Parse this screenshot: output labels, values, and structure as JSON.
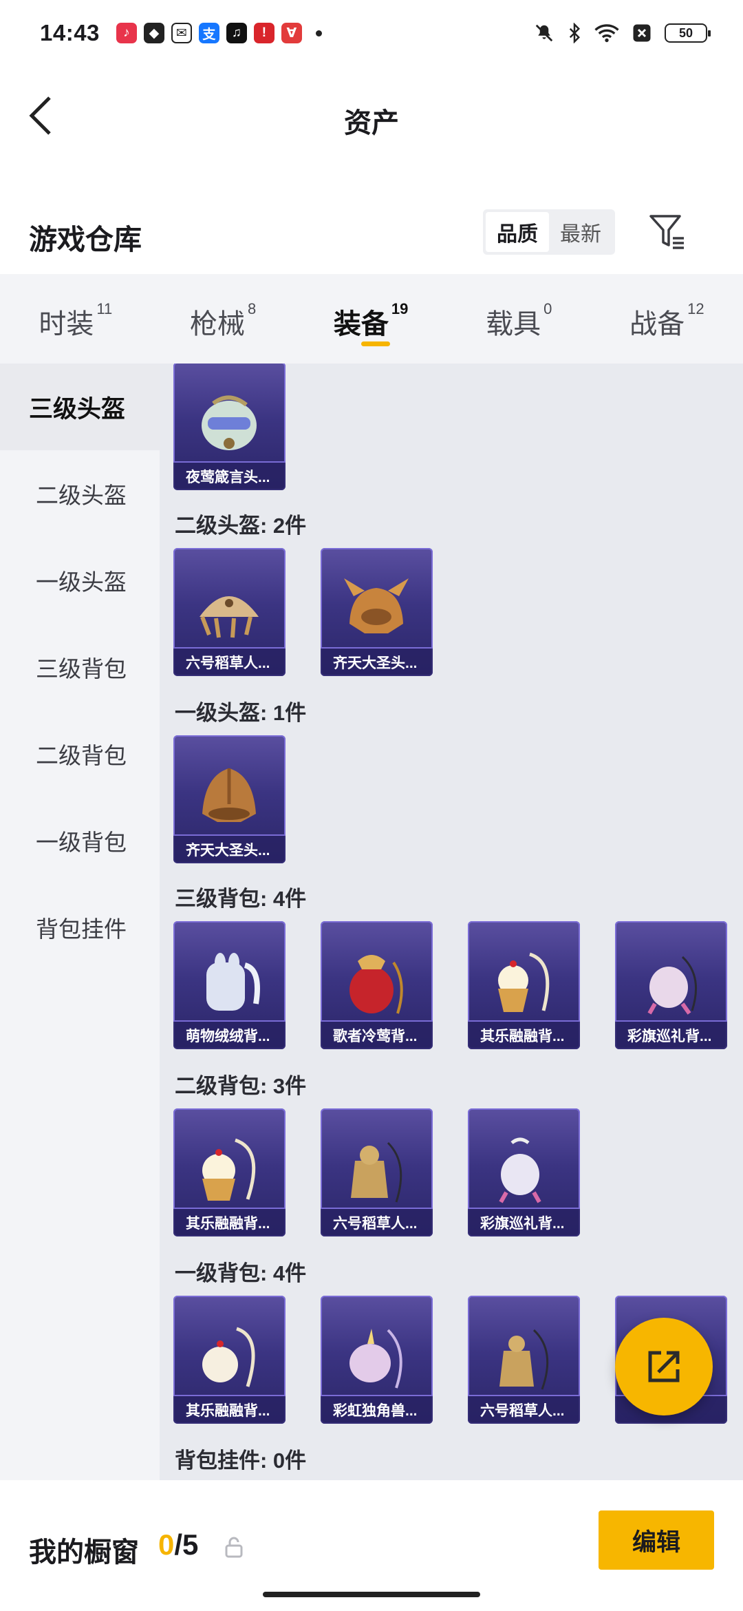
{
  "status_bar": {
    "time": "14:43",
    "battery": "50",
    "notification_icons": [
      "music-icon",
      "shield-app-icon",
      "wechat-icon",
      "alipay-icon",
      "tiktok-icon",
      "red-app-icon",
      "red-app-icon-2"
    ],
    "system_icons": [
      "mute-icon",
      "bluetooth-icon",
      "wifi-icon",
      "sim-off-icon",
      "battery-icon"
    ]
  },
  "header": {
    "title": "资产"
  },
  "section": {
    "title": "游戏仓库",
    "sort_options": [
      "品质",
      "最新"
    ],
    "active_sort": "品质"
  },
  "tabs": [
    {
      "label": "时装",
      "count": "11"
    },
    {
      "label": "枪械",
      "count": "8"
    },
    {
      "label": "装备",
      "count": "19",
      "active": true
    },
    {
      "label": "载具",
      "count": "0"
    },
    {
      "label": "战备",
      "count": "12"
    }
  ],
  "sidebar": {
    "items": [
      "三级头盔",
      "二级头盔",
      "一级头盔",
      "三级背包",
      "二级背包",
      "一级背包",
      "背包挂件"
    ],
    "active": "三级头盔"
  },
  "groups": [
    {
      "label": "",
      "items": [
        "夜莺箴言头..."
      ]
    },
    {
      "label": "二级头盔: 2件",
      "items": [
        "六号稻草人...",
        "齐天大圣头..."
      ]
    },
    {
      "label": "一级头盔: 1件",
      "items": [
        "齐天大圣头..."
      ]
    },
    {
      "label": "三级背包: 4件",
      "items": [
        "萌物绒绒背...",
        "歌者冷莺背...",
        "其乐融融背...",
        "彩旗巡礼背..."
      ]
    },
    {
      "label": "二级背包: 3件",
      "items": [
        "其乐融融背...",
        "六号稻草人...",
        "彩旗巡礼背..."
      ]
    },
    {
      "label": "一级背包: 4件",
      "items": [
        "其乐融融背...",
        "彩虹独角兽...",
        "六号稻草人...",
        ""
      ]
    },
    {
      "label": "背包挂件: 0件",
      "items": []
    }
  ],
  "bottom_bar": {
    "label": "我的橱窗",
    "current": "0",
    "total": "/5",
    "edit_label": "编辑"
  },
  "colors": {
    "accent": "#f6b400",
    "card": "#3b3482",
    "card_border": "#7a6cd6"
  }
}
